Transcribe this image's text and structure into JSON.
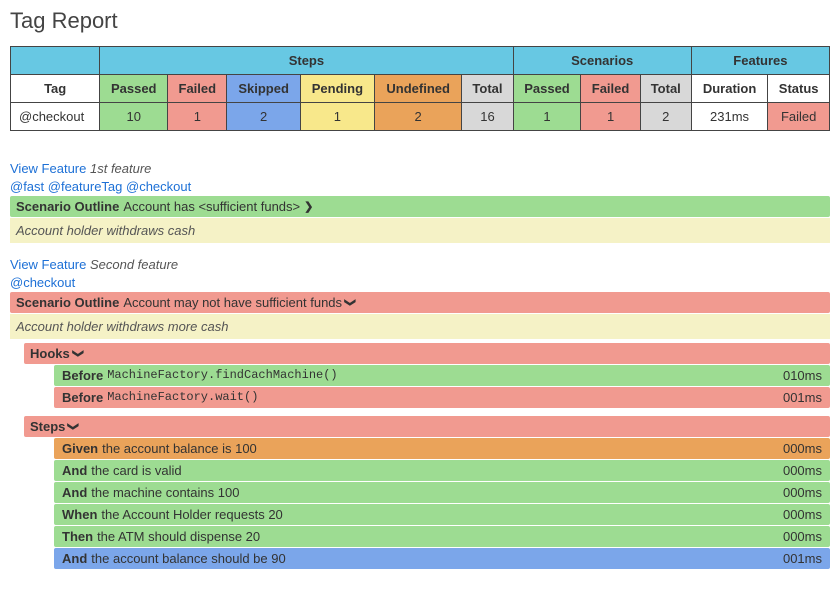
{
  "title": "Tag Report",
  "table": {
    "group_steps": "Steps",
    "group_scenarios": "Scenarios",
    "group_features": "Features",
    "cols": {
      "tag": "Tag",
      "passed": "Passed",
      "failed": "Failed",
      "skipped": "Skipped",
      "pending": "Pending",
      "undefined": "Undefined",
      "total": "Total",
      "s_passed": "Passed",
      "s_failed": "Failed",
      "s_total": "Total",
      "duration": "Duration",
      "status": "Status"
    },
    "row": {
      "tag": "@checkout",
      "passed": "10",
      "failed": "1",
      "skipped": "2",
      "pending": "1",
      "undefined": "2",
      "total": "16",
      "s_passed": "1",
      "s_failed": "1",
      "s_total": "2",
      "duration": "231ms",
      "status": "Failed"
    }
  },
  "view_feature_label": "View Feature",
  "f1": {
    "name": "1st feature",
    "tags": "@fast @featureTag @checkout",
    "scenario_kw": "Scenario Outline",
    "scenario_name": "Account has <sufficient funds>",
    "desc": "Account holder withdraws cash"
  },
  "f2": {
    "name": "Second feature",
    "tags": "@checkout",
    "scenario_kw": "Scenario Outline",
    "scenario_name": "Account may not have sufficient funds",
    "desc": "Account holder withdraws more cash",
    "hooks_label": "Hooks",
    "steps_label": "Steps",
    "hooks": [
      {
        "kw": "Before",
        "code": "MachineFactory.findCachMachine()",
        "dur": "010ms",
        "cls": "row-green"
      },
      {
        "kw": "Before",
        "code": "MachineFactory.wait()",
        "dur": "001ms",
        "cls": "row-red"
      }
    ],
    "steps": [
      {
        "kw": "Given",
        "text": "the account balance is 100",
        "dur": "000ms",
        "cls": "row-orange"
      },
      {
        "kw": "And",
        "text": "the card is valid",
        "dur": "000ms",
        "cls": "row-green"
      },
      {
        "kw": "And",
        "text": "the machine contains 100",
        "dur": "000ms",
        "cls": "row-green"
      },
      {
        "kw": "When",
        "text": "the Account Holder requests 20",
        "dur": "000ms",
        "cls": "row-green"
      },
      {
        "kw": "Then",
        "text": "the ATM should dispense 20",
        "dur": "000ms",
        "cls": "row-green"
      },
      {
        "kw": "And",
        "text": "the account balance should be 90",
        "dur": "001ms",
        "cls": "row-skipblue"
      }
    ]
  },
  "chevrons": {
    "right": "❯",
    "down": "❯"
  }
}
